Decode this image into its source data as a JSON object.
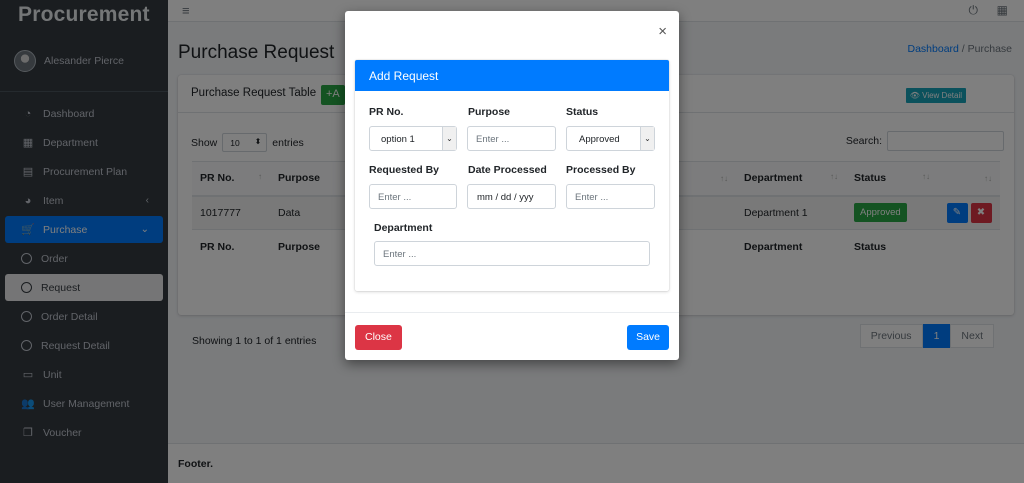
{
  "app": {
    "brand": "Procurement",
    "user": "Alesander Pierce"
  },
  "sidebar": {
    "items": [
      {
        "label": "Dashboard",
        "icon": "dashboard-icon"
      },
      {
        "label": "Department",
        "icon": "building-icon"
      },
      {
        "label": "Procurement Plan",
        "icon": "book-icon"
      },
      {
        "label": "Item",
        "icon": "palette-icon"
      },
      {
        "label": "Purchase",
        "icon": "cart-icon"
      },
      {
        "label": "Order",
        "icon": "circle-icon"
      },
      {
        "label": "Request",
        "icon": "circle-icon"
      },
      {
        "label": "Order Detail",
        "icon": "circle-icon"
      },
      {
        "label": "Request Detail",
        "icon": "circle-icon"
      },
      {
        "label": "Unit",
        "icon": "ticket-icon"
      },
      {
        "label": "User Management",
        "icon": "users-icon"
      },
      {
        "label": "Voucher",
        "icon": "copy-icon"
      }
    ]
  },
  "page": {
    "title": "Purchase Request",
    "breadcrumb": {
      "home": "Dashboard",
      "sep": "/",
      "current": "Purchase"
    }
  },
  "table_card": {
    "title": "Purchase Request Table",
    "add_label": "+A",
    "view_detail": "View Detail",
    "show_label": "Show",
    "entries_value": "10",
    "entries_label": "entries",
    "search_label": "Search:",
    "columns": [
      "PR No.",
      "Purpose",
      "",
      "Department",
      "Status",
      ""
    ],
    "rows": [
      {
        "pr_no": "1017777",
        "purpose": "Data",
        "department": "Department 1",
        "status": "Approved"
      }
    ],
    "showing": "Showing 1 to 1 of 1 entries",
    "pager": {
      "prev": "Previous",
      "page": "1",
      "next": "Next"
    }
  },
  "footer": {
    "text": "Footer."
  },
  "modal": {
    "header": "Add Request",
    "close_x": "×",
    "fields": {
      "pr_no": {
        "label": "PR No.",
        "value": "option 1"
      },
      "purpose": {
        "label": "Purpose",
        "placeholder": "Enter ..."
      },
      "status": {
        "label": "Status",
        "value": "Approved"
      },
      "requested_by": {
        "label": "Requested By",
        "placeholder": "Enter ..."
      },
      "date_processed": {
        "label": "Date Processed",
        "placeholder": "mm / dd / yyy"
      },
      "processed_by": {
        "label": "Processed By",
        "placeholder": "Enter ..."
      },
      "department": {
        "label": "Department",
        "placeholder": "Enter ..."
      }
    },
    "close_label": "Close",
    "save_label": "Save"
  },
  "colors": {
    "primary": "#007bff",
    "success": "#28a745",
    "danger": "#dc3545",
    "sidebar": "#343a40"
  }
}
